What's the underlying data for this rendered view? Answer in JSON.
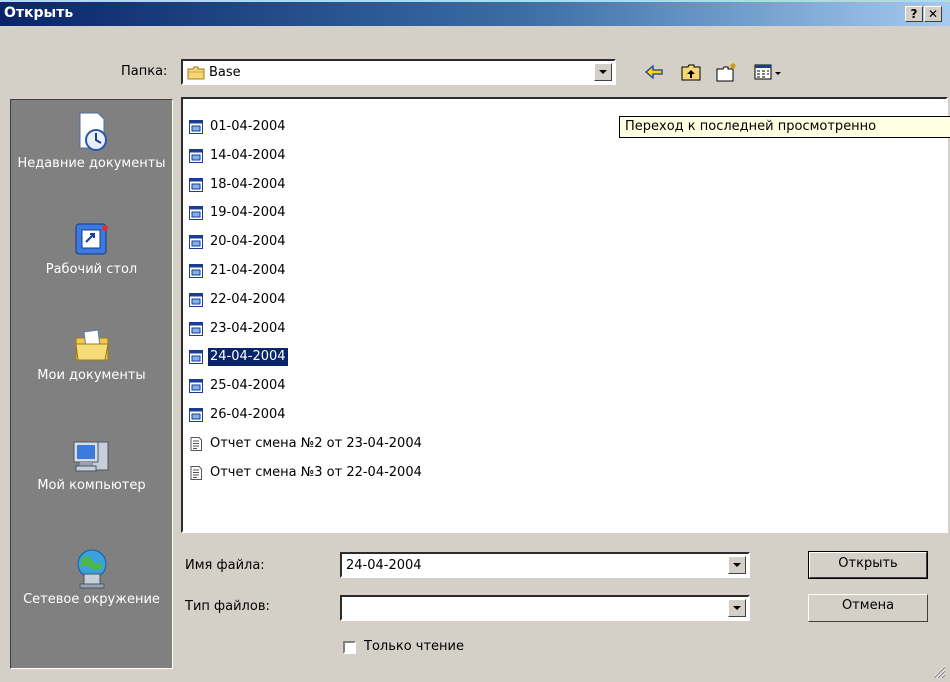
{
  "window": {
    "title": "Открыть",
    "help_glyph": "?",
    "close_glyph": "✕"
  },
  "toolbar": {
    "folder_label": "Папка:",
    "folder_value": "Base",
    "icons": [
      "back-icon",
      "up-folder-icon",
      "new-folder-icon",
      "view-menu-icon"
    ]
  },
  "places": [
    {
      "label": "Недавние документы",
      "icon": "recent-documents-icon"
    },
    {
      "label": "Рабочий стол",
      "icon": "desktop-icon"
    },
    {
      "label": "Мои документы",
      "icon": "my-documents-icon"
    },
    {
      "label": "Мой компьютер",
      "icon": "my-computer-icon"
    },
    {
      "label": "Сетевое окружение",
      "icon": "network-icon"
    }
  ],
  "files": [
    {
      "name": "01-04-2004",
      "type": "db",
      "selected": false
    },
    {
      "name": "14-04-2004",
      "type": "db",
      "selected": false
    },
    {
      "name": "18-04-2004",
      "type": "db",
      "selected": false
    },
    {
      "name": "19-04-2004",
      "type": "db",
      "selected": false
    },
    {
      "name": "20-04-2004",
      "type": "db",
      "selected": false
    },
    {
      "name": "21-04-2004",
      "type": "db",
      "selected": false
    },
    {
      "name": "22-04-2004",
      "type": "db",
      "selected": false
    },
    {
      "name": "23-04-2004",
      "type": "db",
      "selected": false
    },
    {
      "name": "24-04-2004",
      "type": "db",
      "selected": true
    },
    {
      "name": "25-04-2004",
      "type": "db",
      "selected": false
    },
    {
      "name": "26-04-2004",
      "type": "db",
      "selected": false
    },
    {
      "name": "Отчет смена №2 от 23-04-2004",
      "type": "text",
      "selected": false
    },
    {
      "name": "Отчет смена №3 от 22-04-2004",
      "type": "text",
      "selected": false
    }
  ],
  "tooltip": "Переход к последней просмотренно",
  "form": {
    "filename_label": "Имя файла:",
    "filename_value": "24-04-2004",
    "filetype_label": "Тип файлов:",
    "filetype_value": "",
    "readonly_label": "Только чтение",
    "readonly_checked": false
  },
  "buttons": {
    "open": "Открыть",
    "cancel": "Отмена"
  },
  "colors": {
    "face": "#d4d0c8",
    "title_start": "#0a246a",
    "selection": "#0a246a",
    "places_bg": "#808080",
    "tooltip_bg": "#ffffe1"
  }
}
